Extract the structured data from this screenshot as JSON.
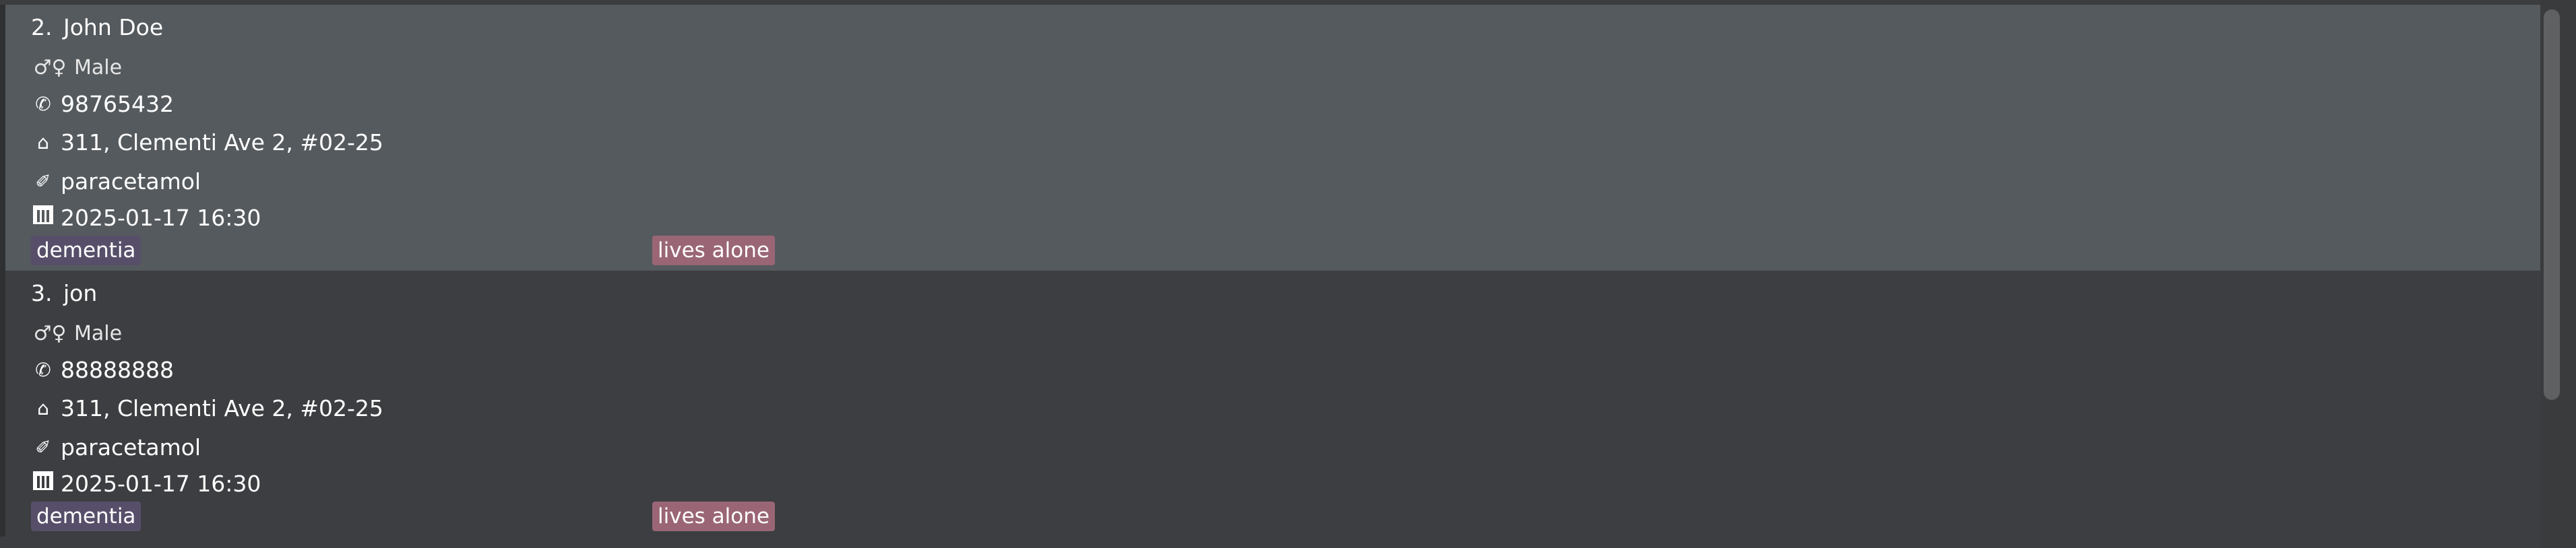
{
  "persons": [
    {
      "index": "2.",
      "name": "John Doe",
      "gender": "Male",
      "phone": "98765432",
      "address": "311, Clementi Ave 2, #02-25",
      "medication": "paracetamol",
      "appointment": "2025-01-17 16:30",
      "tags": [
        "dementia",
        "lives alone"
      ]
    },
    {
      "index": "3.",
      "name": "jon",
      "gender": "Male",
      "phone": "88888888",
      "address": "311, Clementi Ave 2, #02-25",
      "medication": "paracetamol",
      "appointment": "2025-01-17 16:30",
      "tags": [
        "dementia",
        "lives alone"
      ]
    }
  ],
  "icons": {
    "gender": "♂♀",
    "phone": "✆",
    "home": "⌂",
    "pill": "✐"
  },
  "colors": {
    "card_selected": "#555a5e",
    "card_default": "#3c3e41",
    "tag_dementia": "#574f6a",
    "tag_lives_alone": "#9a6676"
  }
}
